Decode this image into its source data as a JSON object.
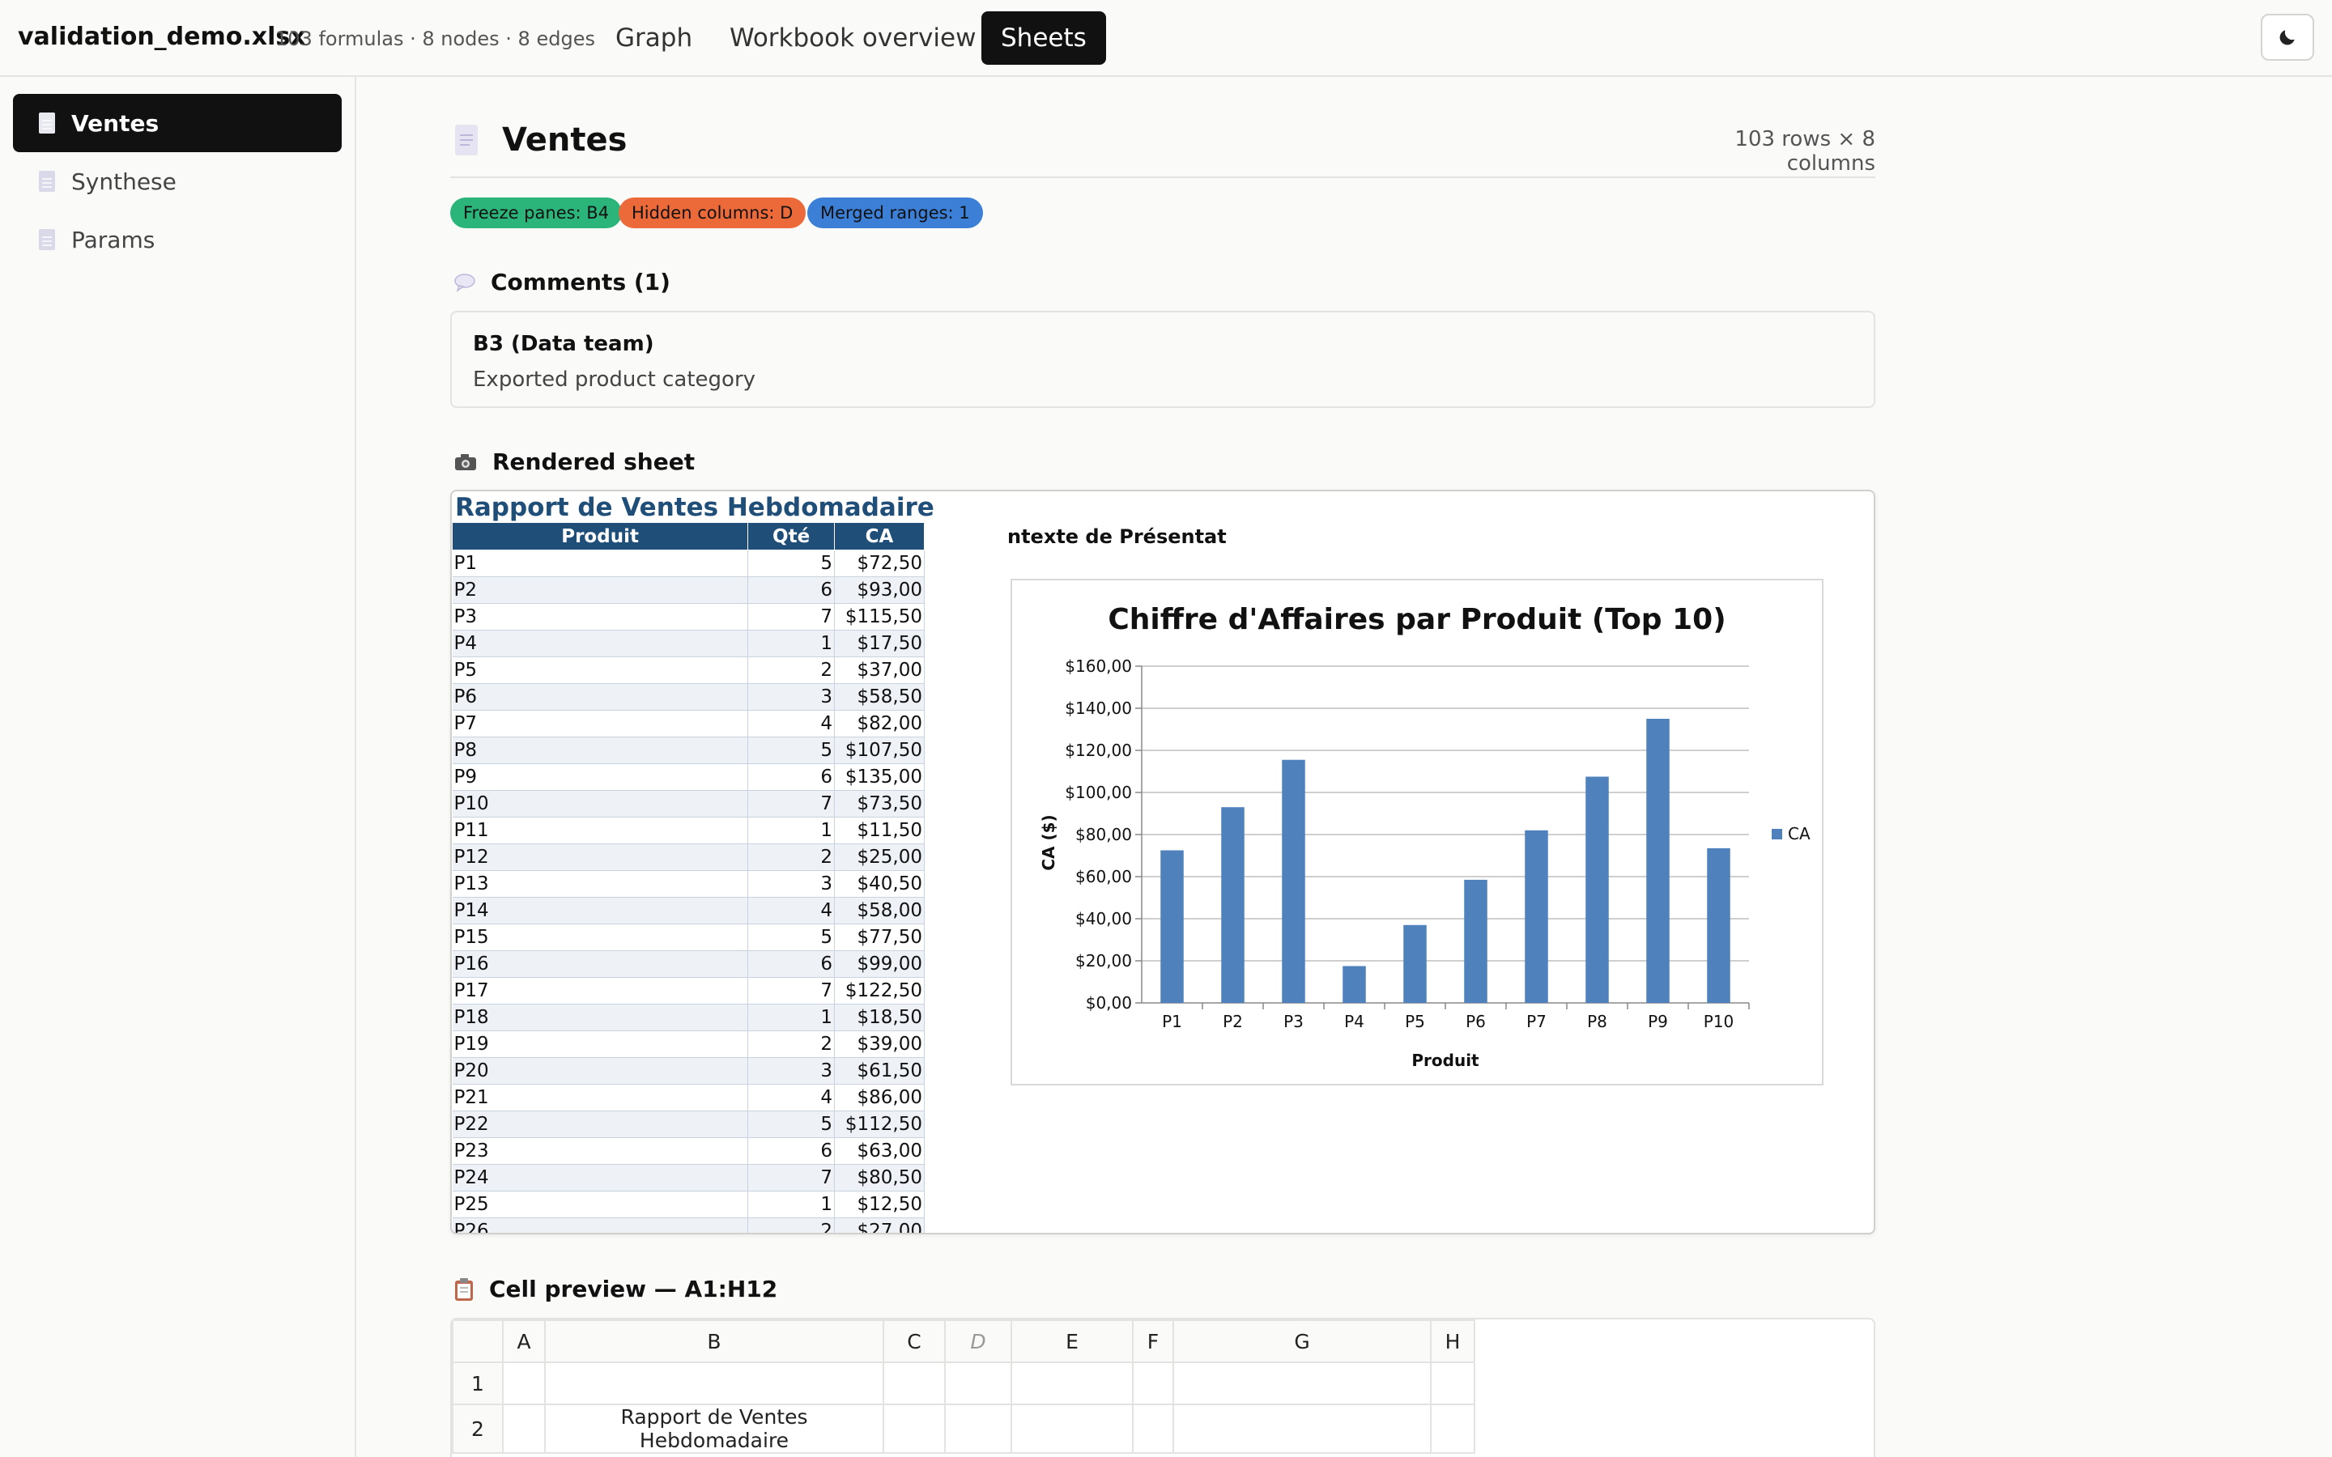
{
  "app": {
    "filename": "validation_demo.xlsx",
    "stats": "103 formulas · 8 nodes · 8 edges",
    "tabs": [
      {
        "label": "Graph"
      },
      {
        "label": "Workbook overview"
      },
      {
        "label": "Sheets"
      }
    ],
    "active_tab": "Sheets",
    "theme_toggle_icon": "moon-icon"
  },
  "sidebar": {
    "items": [
      {
        "label": "Ventes",
        "icon": "document-icon"
      },
      {
        "label": "Synthese",
        "icon": "document-icon"
      },
      {
        "label": "Params",
        "icon": "document-icon"
      }
    ],
    "active": "Ventes"
  },
  "sheet": {
    "title": "Ventes",
    "dimensions": "103 rows × 8 columns",
    "badges": [
      {
        "label": "Freeze panes: B4",
        "color": "#2bb57a"
      },
      {
        "label": "Hidden columns: D",
        "color": "#ec6a3a"
      },
      {
        "label": "Merged ranges: 1",
        "color": "#3b7fd6"
      }
    ]
  },
  "comments": {
    "heading": "Comments (1)",
    "items": [
      {
        "ref": "B3 (Data team)",
        "text": "Exported product category"
      }
    ]
  },
  "rendered": {
    "heading": "Rendered sheet",
    "title": "Rapport de Ventes Hebdomadaire",
    "context_label": "ntexte de Présentat",
    "columns": [
      "Produit",
      "Qté",
      "CA"
    ],
    "rows": [
      [
        "P1",
        "5",
        "$72,50"
      ],
      [
        "P2",
        "6",
        "$93,00"
      ],
      [
        "P3",
        "7",
        "$115,50"
      ],
      [
        "P4",
        "1",
        "$17,50"
      ],
      [
        "P5",
        "2",
        "$37,00"
      ],
      [
        "P6",
        "3",
        "$58,50"
      ],
      [
        "P7",
        "4",
        "$82,00"
      ],
      [
        "P8",
        "5",
        "$107,50"
      ],
      [
        "P9",
        "6",
        "$135,00"
      ],
      [
        "P10",
        "7",
        "$73,50"
      ],
      [
        "P11",
        "1",
        "$11,50"
      ],
      [
        "P12",
        "2",
        "$25,00"
      ],
      [
        "P13",
        "3",
        "$40,50"
      ],
      [
        "P14",
        "4",
        "$58,00"
      ],
      [
        "P15",
        "5",
        "$77,50"
      ],
      [
        "P16",
        "6",
        "$99,00"
      ],
      [
        "P17",
        "7",
        "$122,50"
      ],
      [
        "P18",
        "1",
        "$18,50"
      ],
      [
        "P19",
        "2",
        "$39,00"
      ],
      [
        "P20",
        "3",
        "$61,50"
      ],
      [
        "P21",
        "4",
        "$86,00"
      ],
      [
        "P22",
        "5",
        "$112,50"
      ],
      [
        "P23",
        "6",
        "$63,00"
      ],
      [
        "P24",
        "7",
        "$80,50"
      ],
      [
        "P25",
        "1",
        "$12,50"
      ],
      [
        "P26",
        "2",
        "$27,00"
      ]
    ]
  },
  "chart_data": {
    "type": "bar",
    "title": "Chiffre d'Affaires par Produit (Top 10)",
    "xlabel": "Produit",
    "ylabel": "CA ($)",
    "categories": [
      "P1",
      "P2",
      "P3",
      "P4",
      "P5",
      "P6",
      "P7",
      "P8",
      "P9",
      "P10"
    ],
    "series": [
      {
        "name": "CA",
        "values": [
          72.5,
          93.0,
          115.5,
          17.5,
          37.0,
          58.5,
          82.0,
          107.5,
          135.0,
          73.5
        ],
        "color": "#4f81bd"
      }
    ],
    "ylim": [
      0,
      160
    ],
    "yticks": [
      "$0,00",
      "$20,00",
      "$40,00",
      "$60,00",
      "$80,00",
      "$100,00",
      "$120,00",
      "$140,00",
      "$160,00"
    ],
    "grid": true,
    "legend": "right"
  },
  "preview": {
    "heading": "Cell preview — A1:H12",
    "columns": [
      "",
      "A",
      "B",
      "C",
      "D",
      "E",
      "F",
      "G",
      "H"
    ],
    "rows": [
      [
        "1",
        "",
        "",
        "",
        "",
        "",
        "",
        "",
        ""
      ],
      [
        "2",
        "",
        "Rapport de Ventes Hebdomadaire",
        "",
        "",
        "",
        "",
        "",
        ""
      ]
    ]
  }
}
